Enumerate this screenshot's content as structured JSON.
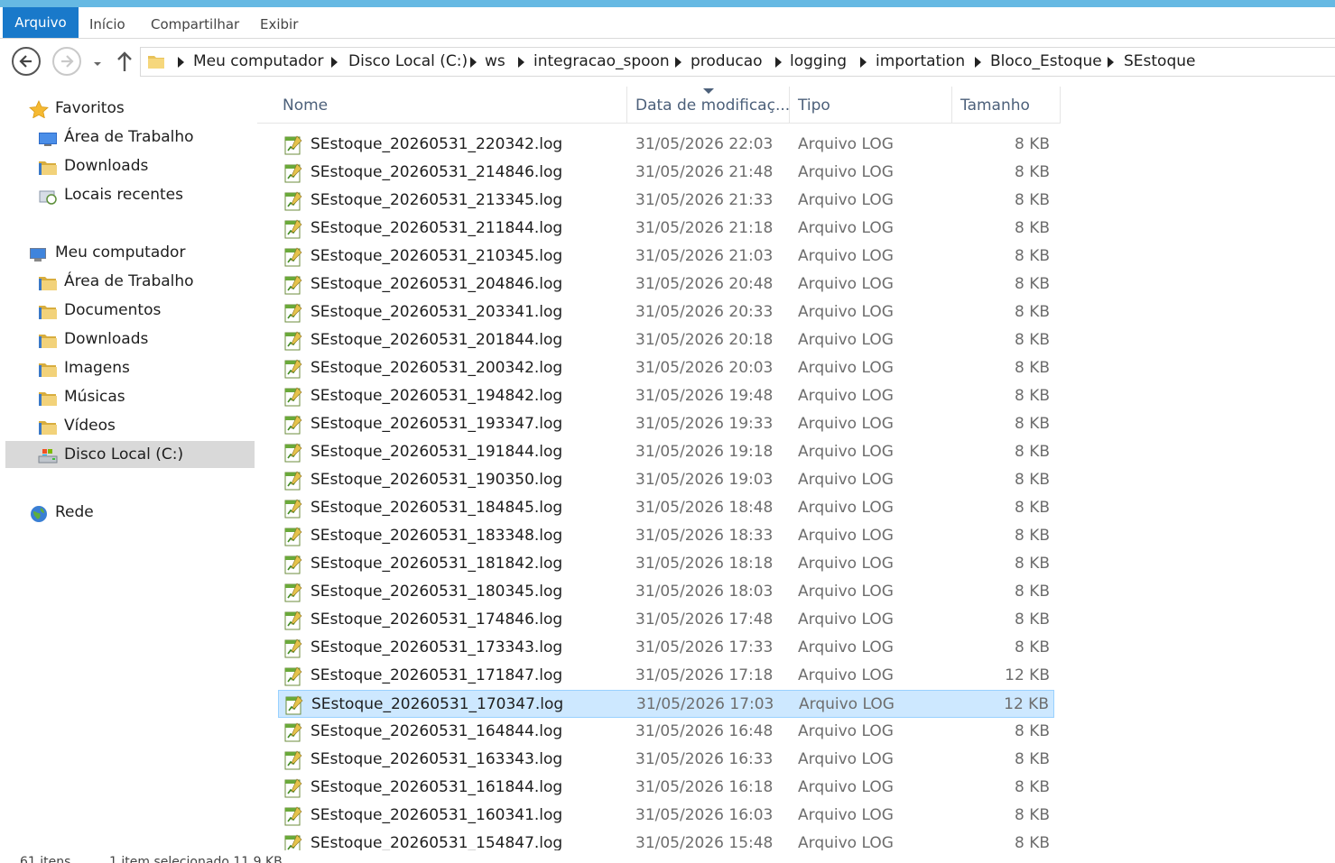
{
  "ribbon": {
    "tabs": [
      "Arquivo",
      "Início",
      "Compartilhar",
      "Exibir"
    ]
  },
  "address": {
    "crumbs": [
      "Meu computador",
      "Disco Local (C:)",
      "ws",
      "integracao_spoon",
      "producao",
      "logging",
      "importation",
      "Bloco_Estoque",
      "SEstoque"
    ]
  },
  "sidebar": {
    "favorites": {
      "label": "Favoritos",
      "items": [
        "Área de Trabalho",
        "Downloads",
        "Locais recentes"
      ]
    },
    "computer": {
      "label": "Meu computador",
      "items": [
        "Área de Trabalho",
        "Documentos",
        "Downloads",
        "Imagens",
        "Músicas",
        "Vídeos",
        "Disco Local (C:)"
      ]
    },
    "network": {
      "label": "Rede"
    }
  },
  "columns": {
    "name": "Nome",
    "date": "Data de modificaç...",
    "type": "Tipo",
    "size": "Tamanho"
  },
  "files": [
    {
      "name": "SEstoque_20260531_220342.log",
      "date": "31/05/2026 22:03",
      "type": "Arquivo LOG",
      "size": "8 KB"
    },
    {
      "name": "SEstoque_20260531_214846.log",
      "date": "31/05/2026 21:48",
      "type": "Arquivo LOG",
      "size": "8 KB"
    },
    {
      "name": "SEstoque_20260531_213345.log",
      "date": "31/05/2026 21:33",
      "type": "Arquivo LOG",
      "size": "8 KB"
    },
    {
      "name": "SEstoque_20260531_211844.log",
      "date": "31/05/2026 21:18",
      "type": "Arquivo LOG",
      "size": "8 KB"
    },
    {
      "name": "SEstoque_20260531_210345.log",
      "date": "31/05/2026 21:03",
      "type": "Arquivo LOG",
      "size": "8 KB"
    },
    {
      "name": "SEstoque_20260531_204846.log",
      "date": "31/05/2026 20:48",
      "type": "Arquivo LOG",
      "size": "8 KB"
    },
    {
      "name": "SEstoque_20260531_203341.log",
      "date": "31/05/2026 20:33",
      "type": "Arquivo LOG",
      "size": "8 KB"
    },
    {
      "name": "SEstoque_20260531_201844.log",
      "date": "31/05/2026 20:18",
      "type": "Arquivo LOG",
      "size": "8 KB"
    },
    {
      "name": "SEstoque_20260531_200342.log",
      "date": "31/05/2026 20:03",
      "type": "Arquivo LOG",
      "size": "8 KB"
    },
    {
      "name": "SEstoque_20260531_194842.log",
      "date": "31/05/2026 19:48",
      "type": "Arquivo LOG",
      "size": "8 KB"
    },
    {
      "name": "SEstoque_20260531_193347.log",
      "date": "31/05/2026 19:33",
      "type": "Arquivo LOG",
      "size": "8 KB"
    },
    {
      "name": "SEstoque_20260531_191844.log",
      "date": "31/05/2026 19:18",
      "type": "Arquivo LOG",
      "size": "8 KB"
    },
    {
      "name": "SEstoque_20260531_190350.log",
      "date": "31/05/2026 19:03",
      "type": "Arquivo LOG",
      "size": "8 KB"
    },
    {
      "name": "SEstoque_20260531_184845.log",
      "date": "31/05/2026 18:48",
      "type": "Arquivo LOG",
      "size": "8 KB"
    },
    {
      "name": "SEstoque_20260531_183348.log",
      "date": "31/05/2026 18:33",
      "type": "Arquivo LOG",
      "size": "8 KB"
    },
    {
      "name": "SEstoque_20260531_181842.log",
      "date": "31/05/2026 18:18",
      "type": "Arquivo LOG",
      "size": "8 KB"
    },
    {
      "name": "SEstoque_20260531_180345.log",
      "date": "31/05/2026 18:03",
      "type": "Arquivo LOG",
      "size": "8 KB"
    },
    {
      "name": "SEstoque_20260531_174846.log",
      "date": "31/05/2026 17:48",
      "type": "Arquivo LOG",
      "size": "8 KB"
    },
    {
      "name": "SEstoque_20260531_173343.log",
      "date": "31/05/2026 17:33",
      "type": "Arquivo LOG",
      "size": "8 KB"
    },
    {
      "name": "SEstoque_20260531_171847.log",
      "date": "31/05/2026 17:18",
      "type": "Arquivo LOG",
      "size": "12 KB"
    },
    {
      "name": "SEstoque_20260531_170347.log",
      "date": "31/05/2026 17:03",
      "type": "Arquivo LOG",
      "size": "12 KB",
      "selected": true
    },
    {
      "name": "SEstoque_20260531_164844.log",
      "date": "31/05/2026 16:48",
      "type": "Arquivo LOG",
      "size": "8 KB"
    },
    {
      "name": "SEstoque_20260531_163343.log",
      "date": "31/05/2026 16:33",
      "type": "Arquivo LOG",
      "size": "8 KB"
    },
    {
      "name": "SEstoque_20260531_161844.log",
      "date": "31/05/2026 16:18",
      "type": "Arquivo LOG",
      "size": "8 KB"
    },
    {
      "name": "SEstoque_20260531_160341.log",
      "date": "31/05/2026 16:03",
      "type": "Arquivo LOG",
      "size": "8 KB"
    },
    {
      "name": "SEstoque_20260531_154847.log",
      "date": "31/05/2026 15:48",
      "type": "Arquivo LOG",
      "size": "8 KB"
    }
  ],
  "status": {
    "item_count": "61 itens",
    "selection": "1 item selecionado  11,9 KB"
  },
  "colors": {
    "accent": "#1979ca",
    "selection": "#cde8ff",
    "selection_border": "#99d1ff",
    "header_text": "#4c607a"
  },
  "icons": {
    "favorites": "star-icon",
    "folder": "folder-icon",
    "file": "log-file-icon",
    "network": "globe-icon",
    "drive": "drive-icon",
    "computer": "computer-icon"
  }
}
